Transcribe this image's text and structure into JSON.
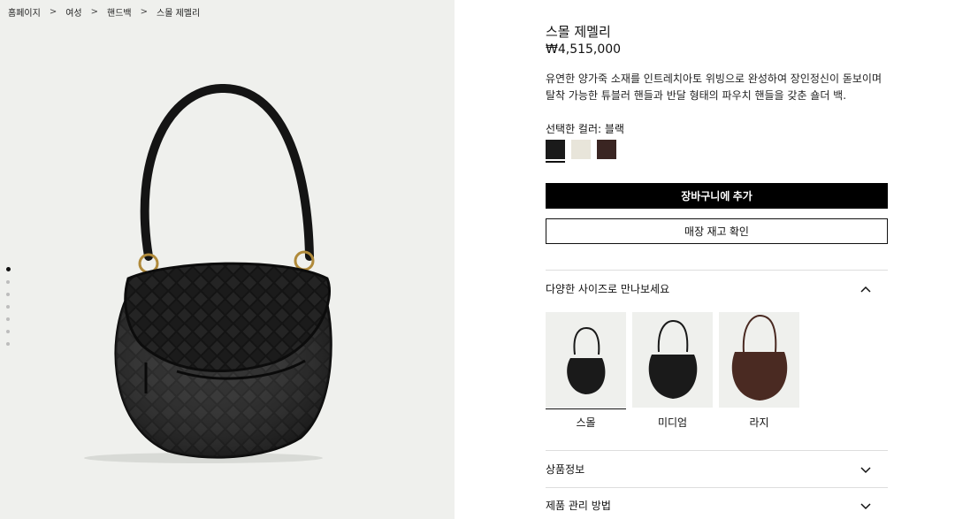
{
  "breadcrumb": [
    "홈페이지",
    "여성",
    "핸드백",
    "스몰 제멜리"
  ],
  "breadcrumb_separator": ">",
  "gallery": {
    "slide_count": 7,
    "active_slide": 1
  },
  "product": {
    "title": "스몰 제멜리",
    "price": "₩4,515,000",
    "description": "유연한 양가죽 소재를 인트레치아토 위빙으로 완성하여 장인정신이 돋보이며 탈착 가능한 튜블러 핸들과 반달 형태의 파우치 핸들을 갖춘 숄더 백.",
    "selected_color_label": "선택한 컬러: 블랙",
    "colors": [
      {
        "name": "black",
        "hex": "#1a1a1a",
        "selected": true
      },
      {
        "name": "cream",
        "hex": "#e8e5da",
        "selected": false
      },
      {
        "name": "dark-brown",
        "hex": "#3a2522",
        "selected": false
      }
    ],
    "add_to_cart_label": "장바구니에 추가",
    "check_stock_label": "매장 재고 확인"
  },
  "sizes_section": {
    "title": "다양한 사이즈로 만나보세요",
    "expanded": true,
    "items": [
      {
        "label": "스몰",
        "selected": true,
        "color": "#1a1a1a"
      },
      {
        "label": "미디엄",
        "selected": false,
        "color": "#1a1a1a"
      },
      {
        "label": "라지",
        "selected": false,
        "color": "#4a2a22"
      }
    ]
  },
  "accordions": [
    {
      "title": "상품정보",
      "expanded": false
    },
    {
      "title": "제품 관리 방법",
      "expanded": false
    }
  ],
  "colors": {
    "gallery_bg": "#eff0ed",
    "primary_button": "#000000"
  }
}
